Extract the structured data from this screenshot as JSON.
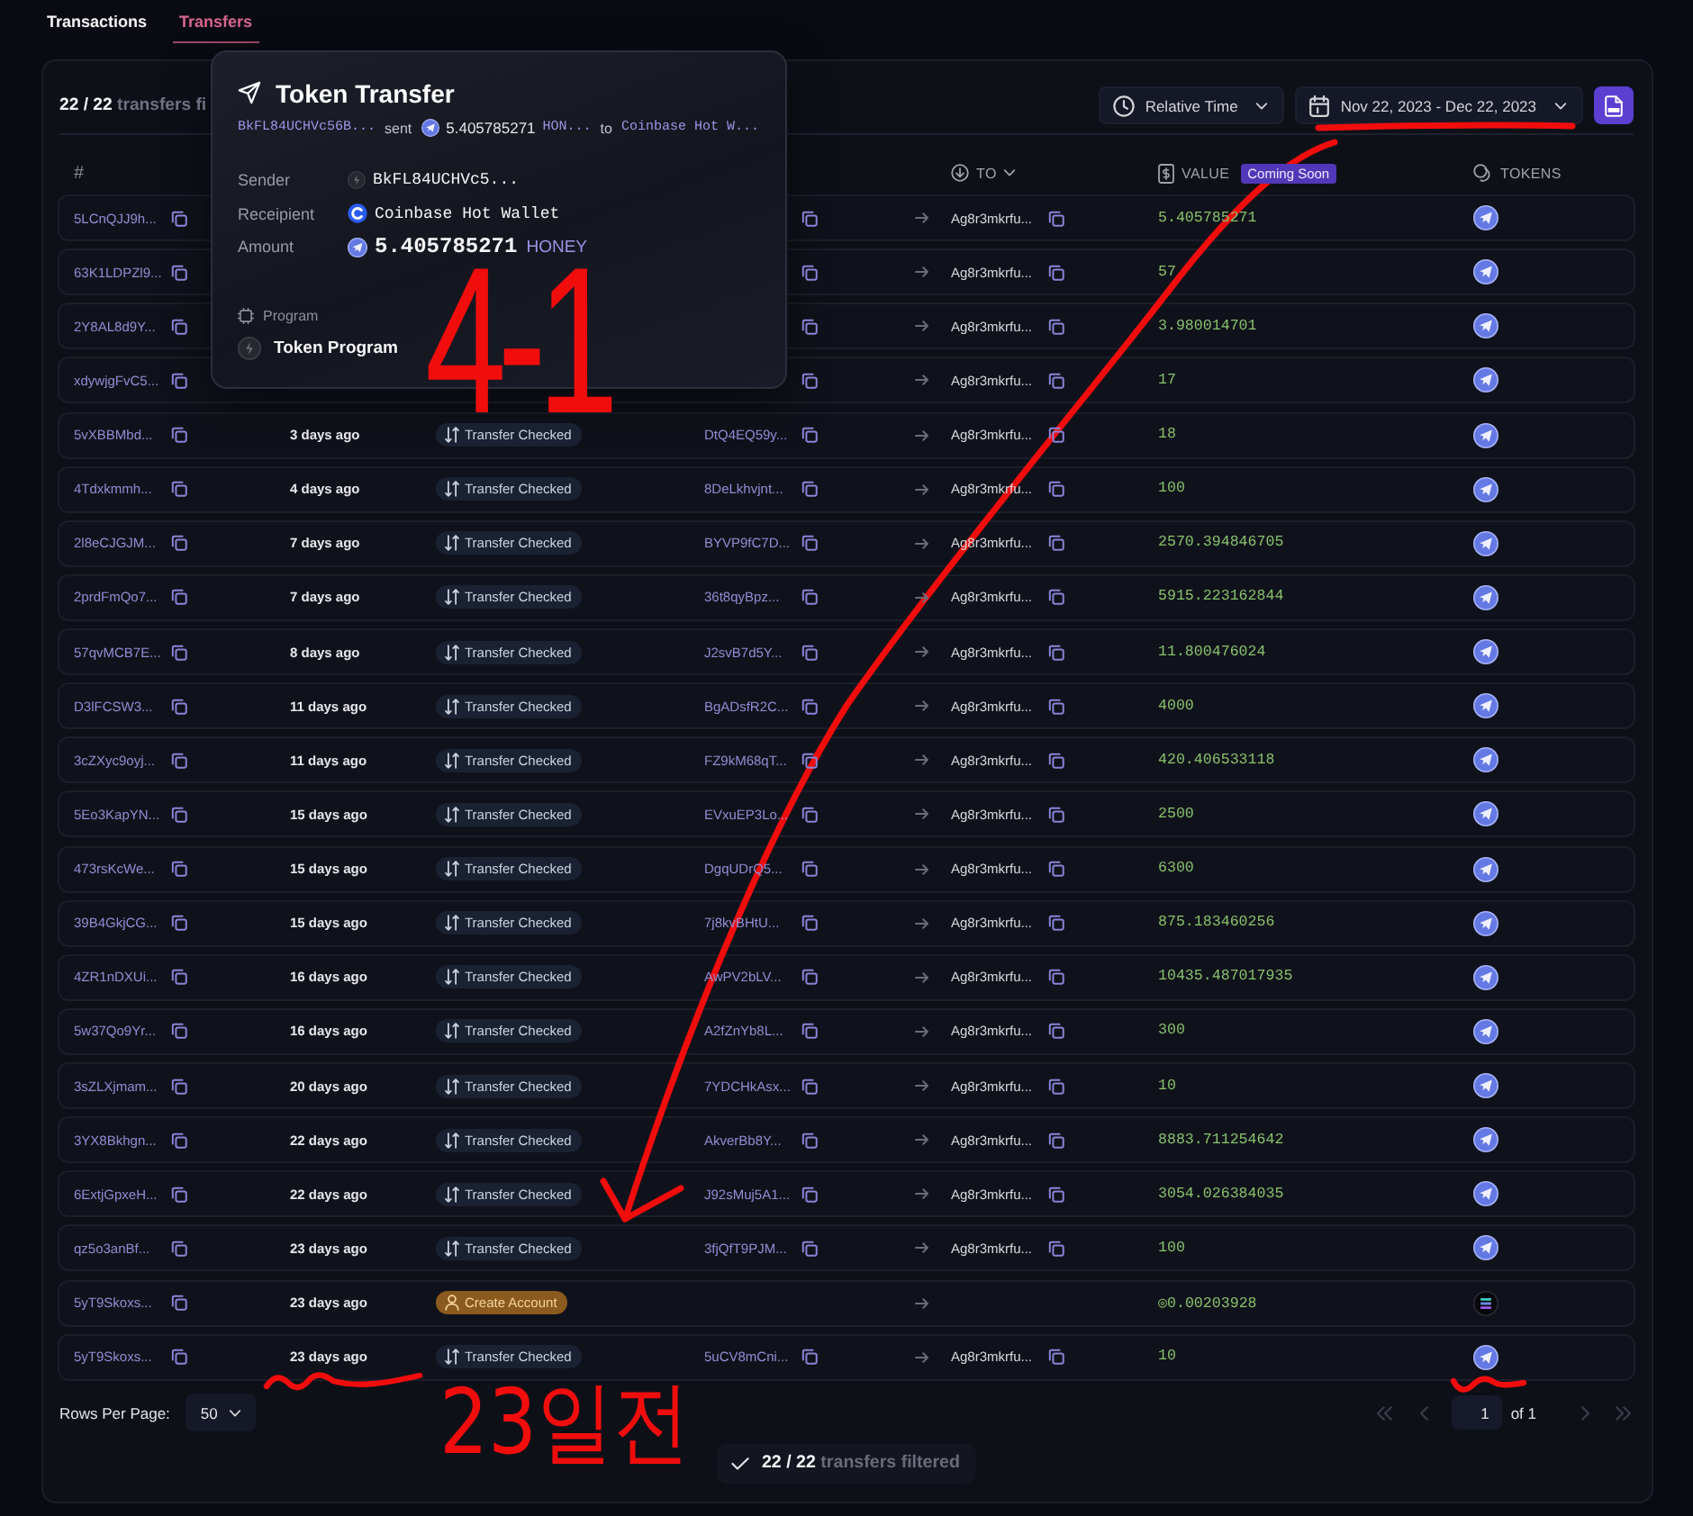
{
  "tabs": [
    {
      "label": "Transactions",
      "selected": false
    },
    {
      "label": "Transfers",
      "selected": true
    }
  ],
  "summary": "**22 / 22** transfers fi",
  "toolbar": {
    "time_format": "Relative Time",
    "date_range": "Nov 22, 2023 - Dec 22, 2023"
  },
  "table": {
    "columns": [
      {
        "kind": "hash",
        "label": "#",
        "sortable": false
      },
      {
        "kind": "to",
        "label": "TO",
        "sortable": true
      },
      {
        "kind": "value",
        "label": "VALUE",
        "sortable": false,
        "badge": "Coming Soon"
      },
      {
        "kind": "tokens",
        "label": "TOKENS",
        "sortable": false
      }
    ],
    "rows": [
      {
        "kind": "transfer",
        "hash": "5LCnQJJ9h...",
        "to": "Ag8r3mkrfu...",
        "value": "5.405785271"
      },
      {
        "kind": "transfer",
        "hash": "63K1LDPZl9...",
        "to": "Ag8r3mkrfu...",
        "value": "57"
      },
      {
        "kind": "transfer",
        "hash": "2Y8AL8d9Y...",
        "to": "Ag8r3mkrfu...",
        "value": "3.980014701"
      },
      {
        "kind": "transfer",
        "hash": "xdywjgFvC5...",
        "to": "Ag8r3mkrfu...",
        "value": "17"
      },
      {
        "kind": "transfer",
        "hash": "5vXBBMbd...",
        "time": "3 days ago",
        "type": "Transfer Checked",
        "from": "DtQ4EQ59y...",
        "to": "Ag8r3mkrfu...",
        "value": "18"
      },
      {
        "kind": "transfer",
        "hash": "4Tdxkmmh...",
        "time": "4 days ago",
        "type": "Transfer Checked",
        "from": "8DeLkhvjnt...",
        "to": "Ag8r3mkrfu...",
        "value": "100"
      },
      {
        "kind": "transfer",
        "hash": "2l8eCJGJM...",
        "time": "7 days ago",
        "type": "Transfer Checked",
        "from": "BYVP9fC7D...",
        "to": "Ag8r3mkrfu...",
        "value": "2570.394846705"
      },
      {
        "kind": "transfer",
        "hash": "2prdFmQo7...",
        "time": "7 days ago",
        "type": "Transfer Checked",
        "from": "36t8qyBpz...",
        "to": "Ag8r3mkrfu...",
        "value": "5915.223162844"
      },
      {
        "kind": "transfer",
        "hash": "57qvMCB7E...",
        "time": "8 days ago",
        "type": "Transfer Checked",
        "from": "J2svB7d5Y...",
        "to": "Ag8r3mkrfu...",
        "value": "11.800476024"
      },
      {
        "kind": "transfer",
        "hash": "D3lFCSW3...",
        "time": "11 days ago",
        "type": "Transfer Checked",
        "from": "BgADsfR2C...",
        "to": "Ag8r3mkrfu...",
        "value": "4000"
      },
      {
        "kind": "transfer",
        "hash": "3cZXyc9oyj...",
        "time": "11 days ago",
        "type": "Transfer Checked",
        "from": "FZ9kM68qT...",
        "to": "Ag8r3mkrfu...",
        "value": "420.406533118"
      },
      {
        "kind": "transfer",
        "hash": "5Eo3KapYN...",
        "time": "15 days ago",
        "type": "Transfer Checked",
        "from": "EVxuEP3Lo...",
        "to": "Ag8r3mkrfu...",
        "value": "2500"
      },
      {
        "kind": "transfer",
        "hash": "473rsKcWe...",
        "time": "15 days ago",
        "type": "Transfer Checked",
        "from": "DgqUDrQ5...",
        "to": "Ag8r3mkrfu...",
        "value": "6300"
      },
      {
        "kind": "transfer",
        "hash": "39B4GkjCG...",
        "time": "15 days ago",
        "type": "Transfer Checked",
        "from": "7j8kvBHtU...",
        "to": "Ag8r3mkrfu...",
        "value": "875.183460256"
      },
      {
        "kind": "transfer",
        "hash": "4ZR1nDXUi...",
        "time": "16 days ago",
        "type": "Transfer Checked",
        "from": "AwPV2bLV...",
        "to": "Ag8r3mkrfu...",
        "value": "10435.487017935"
      },
      {
        "kind": "transfer",
        "hash": "5w37Qo9Yr...",
        "time": "16 days ago",
        "type": "Transfer Checked",
        "from": "A2fZnYb8L...",
        "to": "Ag8r3mkrfu...",
        "value": "300"
      },
      {
        "kind": "transfer",
        "hash": "3sZLXjmam...",
        "time": "20 days ago",
        "type": "Transfer Checked",
        "from": "7YDCHkAsx...",
        "to": "Ag8r3mkrfu...",
        "value": "10"
      },
      {
        "kind": "transfer",
        "hash": "3YX8Bkhgn...",
        "time": "22 days ago",
        "type": "Transfer Checked",
        "from": "AkverBb8Y...",
        "to": "Ag8r3mkrfu...",
        "value": "8883.711254642"
      },
      {
        "kind": "transfer",
        "hash": "6ExtjGpxeH...",
        "time": "22 days ago",
        "type": "Transfer Checked",
        "from": "J92sMuj5A1...",
        "to": "Ag8r3mkrfu...",
        "value": "3054.026384035"
      },
      {
        "kind": "transfer",
        "hash": "qz5o3anBf...",
        "time": "23 days ago",
        "type": "Transfer Checked",
        "from": "3fjQfT9PJM...",
        "to": "Ag8r3mkrfu...",
        "value": "100"
      },
      {
        "kind": "create_account",
        "hash": "5yT9Skoxs...",
        "time": "23 days ago",
        "type": "Create Account",
        "value": "◎0.00203928"
      },
      {
        "kind": "transfer",
        "hash": "5yT9Skoxs...",
        "time": "23 days ago",
        "type": "Transfer Checked",
        "from": "5uCV8mCni...",
        "to": "Ag8r3mkrfu...",
        "value": "10"
      }
    ]
  },
  "footer": {
    "rows_per_page_label": "Rows Per Page:",
    "rows_per_page": "50",
    "page": "1",
    "page_count": "of 1",
    "nav": [
      {
        "kind": "first",
        "disabled": true
      },
      {
        "kind": "prev",
        "disabled": true
      },
      {
        "kind": "next",
        "disabled": true
      },
      {
        "kind": "last",
        "disabled": true
      }
    ]
  },
  "filter_status": "**22 / 22** transfers filtered",
  "tooltip": {
    "title": "Token Transfer",
    "summary": [
      {
        "kind": "address",
        "text": "BkFL84UCHVc56B..."
      },
      {
        "kind": "word",
        "text": "sent"
      },
      {
        "kind": "amount",
        "text": "5.405785271"
      },
      {
        "kind": "symbol",
        "text": "HON..."
      },
      {
        "kind": "word",
        "text": "to"
      },
      {
        "kind": "address",
        "text": "Coinbase Hot W..."
      }
    ],
    "fields": [
      {
        "kind": "sender",
        "label": "Sender",
        "value": "BkFL84UCHVc5..."
      },
      {
        "kind": "recipient",
        "label": "Receipient",
        "value": "Coinbase Hot Wallet"
      },
      {
        "kind": "amount",
        "label": "Amount",
        "value": "5.405785271",
        "symbol": "HONEY"
      }
    ],
    "program_label": "Program",
    "program": "Token Program"
  },
  "annotations": [
    {
      "kind": "handwriting",
      "text": "4-1"
    },
    {
      "kind": "underline"
    },
    {
      "kind": "arrow"
    },
    {
      "kind": "handwriting",
      "text": "23일전"
    },
    {
      "kind": "squiggle"
    },
    {
      "kind": "squiggle"
    }
  ]
}
